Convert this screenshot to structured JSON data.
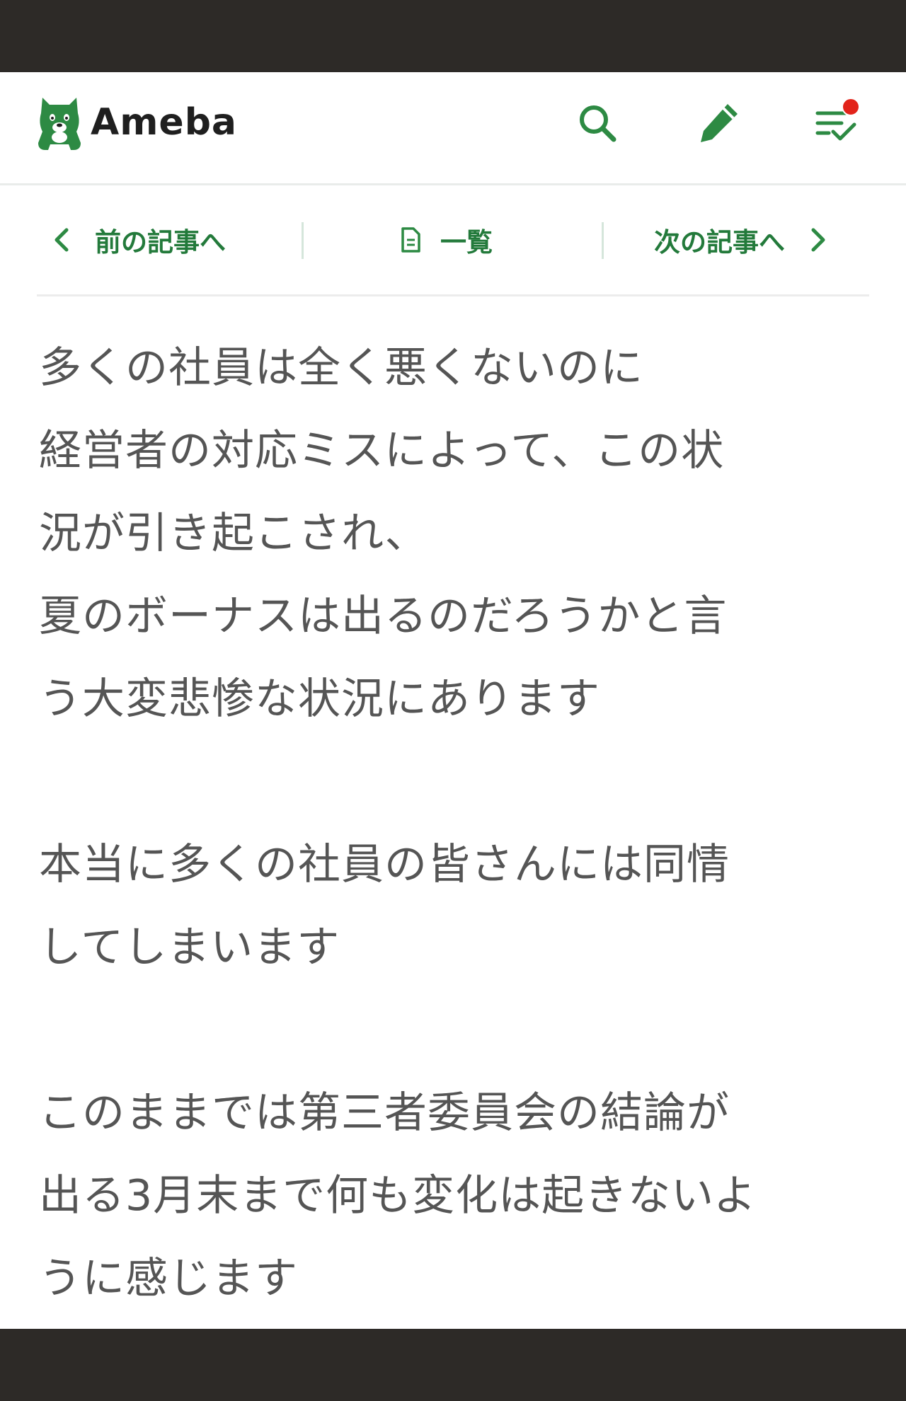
{
  "header": {
    "logo_text": "Ameba",
    "search_icon": "search-icon",
    "write_icon": "pencil-icon",
    "feed_icon": "feed-check-icon",
    "accent_color": "#2d8a43",
    "notification_color": "#e2231a"
  },
  "pager": {
    "prev_label": "前の記事へ",
    "list_label": "一覧",
    "next_label": "次の記事へ"
  },
  "article": {
    "lines": [
      "多くの社員は全く悪くないのに",
      "経営者の対応ミスによって、この状",
      "況が引き起こされ、",
      "夏のボーナスは出るのだろうかと言",
      "う大変悲惨な状況にあります",
      "",
      "本当に多くの社員の皆さんには同情",
      "してしまいます",
      "",
      "このままでは第三者委員会の結論が",
      "出る3月末まで何も変化は起きないよ",
      "うに感じます"
    ]
  }
}
